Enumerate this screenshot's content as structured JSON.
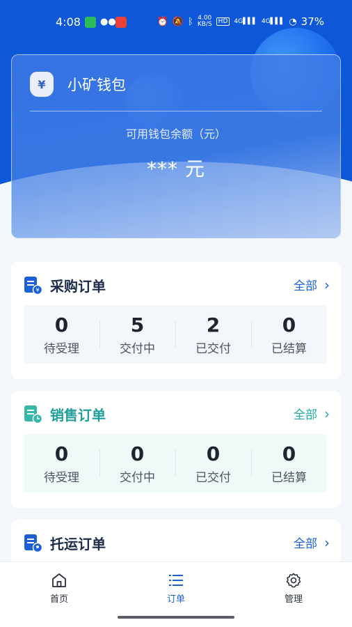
{
  "status_bar": {
    "time": "4:08",
    "net_speed_top": "4.00",
    "net_speed_unit": "KB/S",
    "battery": "37%",
    "hd_label": "HD",
    "signal_1": "4G",
    "signal_2": "4G"
  },
  "wallet": {
    "title": "小矿钱包",
    "balance_label": "可用钱包余额（元）",
    "balance_value": "*** 元",
    "icon_symbol": "¥"
  },
  "orders": {
    "purchase": {
      "title": "采购订单",
      "all_label": "全部",
      "stats": [
        {
          "value": "0",
          "label": "待受理"
        },
        {
          "value": "5",
          "label": "交付中"
        },
        {
          "value": "2",
          "label": "已交付"
        },
        {
          "value": "0",
          "label": "已结算"
        }
      ]
    },
    "sales": {
      "title": "销售订单",
      "all_label": "全部",
      "stats": [
        {
          "value": "0",
          "label": "待受理"
        },
        {
          "value": "0",
          "label": "交付中"
        },
        {
          "value": "0",
          "label": "已交付"
        },
        {
          "value": "0",
          "label": "已结算"
        }
      ]
    },
    "shipping": {
      "title": "托运订单",
      "all_label": "全部"
    }
  },
  "bottom_nav": {
    "items": [
      {
        "label": "首页",
        "icon": "home-icon"
      },
      {
        "label": "订单",
        "icon": "list-icon"
      },
      {
        "label": "管理",
        "icon": "gear-icon"
      }
    ],
    "active": "订单"
  },
  "colors": {
    "brand_blue": "#0e57d8",
    "accent_blue": "#1d5fd6",
    "accent_teal": "#1fa79f",
    "background": "#f3f6fb"
  }
}
